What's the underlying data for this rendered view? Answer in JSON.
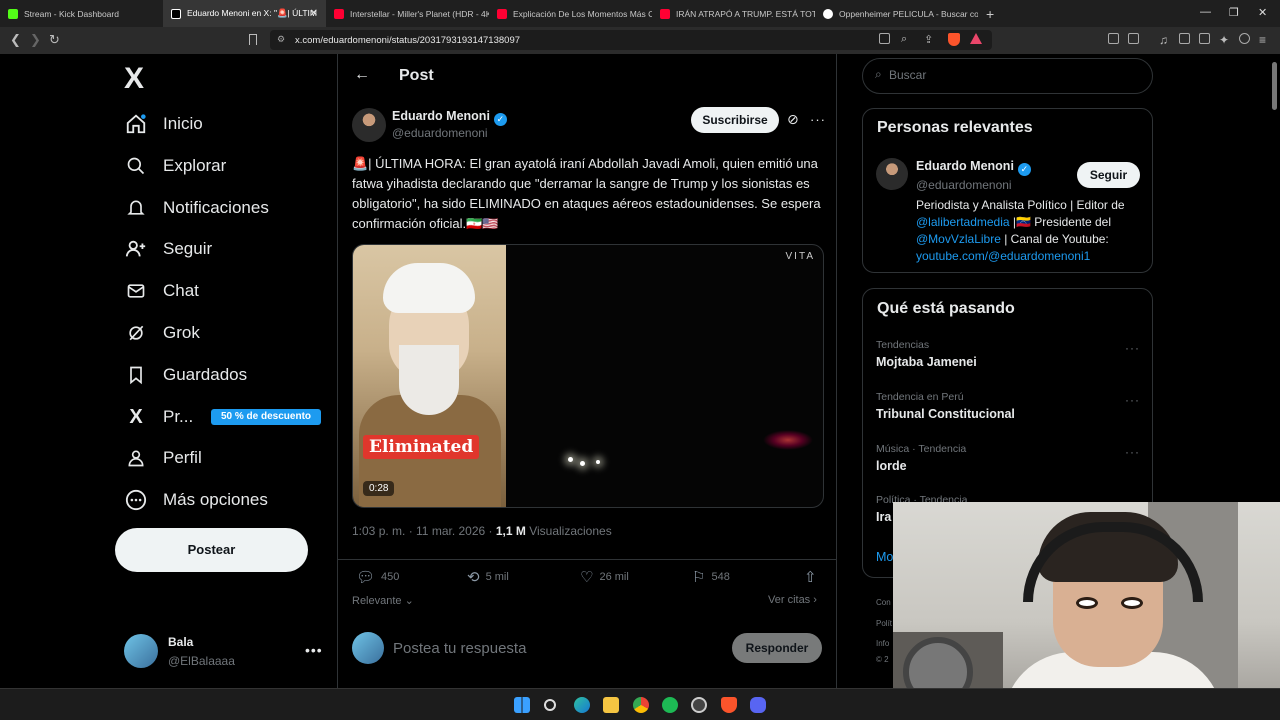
{
  "browser": {
    "tabs": [
      {
        "title": "Stream - Kick Dashboard",
        "color": "#53fc18",
        "active": false
      },
      {
        "title": "Eduardo Menoni en X: \"🚨| ÚLTIM",
        "color": "#ffffff",
        "active": true
      },
      {
        "title": "Interstellar - Miller's Planet (HDR - 4K",
        "color": "#ff0033",
        "active": false
      },
      {
        "title": "Explicación De Los Momentos Más C",
        "color": "#ff0033",
        "active": false
      },
      {
        "title": "IRÁN ATRAPÓ A TRUMP. ESTÁ TOTAL",
        "color": "#ff0033",
        "active": false
      },
      {
        "title": "Oppenheimer PELICULA - Buscar cor",
        "color": "#4285f4",
        "active": false
      }
    ],
    "new_tab": "+",
    "url": "x.com/eduardomenoni/status/2031793193147138097"
  },
  "sidebar": {
    "logo": "X",
    "items": [
      {
        "label": "Inicio",
        "icon": "home-icon"
      },
      {
        "label": "Explorar",
        "icon": "search-icon"
      },
      {
        "label": "Notificaciones",
        "icon": "bell-icon"
      },
      {
        "label": "Seguir",
        "icon": "follow-icon"
      },
      {
        "label": "Chat",
        "icon": "mail-icon"
      },
      {
        "label": "Grok",
        "icon": "grok-icon"
      },
      {
        "label": "Guardados",
        "icon": "bookmark-icon"
      },
      {
        "label": "Pr...",
        "icon": "x-premium-icon"
      },
      {
        "label": "Perfil",
        "icon": "profile-icon"
      },
      {
        "label": "Más opciones",
        "icon": "more-icon"
      }
    ],
    "premium_badge": "50 % de descuento",
    "post_button": "Postear",
    "account": {
      "name": "Bala",
      "handle": "@ElBalaaaa"
    }
  },
  "main": {
    "header_title": "Post",
    "author": {
      "name": "Eduardo Menoni",
      "handle": "@eduardomenoni"
    },
    "subscribe_label": "Suscribirse",
    "tweet_text": "🚨| ÚLTIMA HORA: El gran ayatolá iraní Abdollah Javadi Amoli, quien emitió una fatwa yihadista declarando que \"derramar la sangre de Trump y los sionistas es obligatorio\", ha sido ELIMINADO en ataques aéreos estadounidenses. Se espera confirmación oficial.🇮🇷🇺🇸",
    "media": {
      "overlay_text": "Eliminated",
      "duration": "0:28",
      "watermark": "VITA"
    },
    "meta": {
      "time": "1:03 p. m. · 11 mar. 2026 · ",
      "views": "1,1 M",
      "views_label": " Visualizaciones"
    },
    "actions": {
      "replies": "450",
      "reposts": "5 mil",
      "likes": "26 mil",
      "bookmarks": "548"
    },
    "sort_label": "Relevante",
    "quotes_label": "Ver citas",
    "reply_placeholder": "Postea tu respuesta",
    "reply_button": "Responder"
  },
  "right": {
    "search_placeholder": "Buscar",
    "relevant_title": "Personas relevantes",
    "relevant": {
      "name": "Eduardo Menoni",
      "handle": "@eduardomenoni",
      "follow_label": "Seguir",
      "bio_1": "Periodista y Analista Político | Editor de ",
      "bio_link1": "@lalibertadmedia",
      "bio_2": " |🇻🇪 Presidente del ",
      "bio_link2": "@MovVzlaLibre",
      "bio_3": " | Canal de Youtube: ",
      "bio_link3": "youtube.com/@eduardomenoni1"
    },
    "trends_title": "Qué está pasando",
    "trends": [
      {
        "category": "Tendencias",
        "name": "Mojtaba Jamenei"
      },
      {
        "category": "Tendencia en Perú",
        "name": "Tribunal Constitucional"
      },
      {
        "category": "Música · Tendencia",
        "name": "lorde"
      },
      {
        "category": "Política · Tendencia",
        "name": "Ira"
      }
    ],
    "show_more": "Mo",
    "footer": [
      "Con",
      "Polít",
      "Info",
      "© 2"
    ]
  },
  "colors": {
    "accent": "#1d9bf0",
    "background": "#000000",
    "border": "#2f3336"
  }
}
